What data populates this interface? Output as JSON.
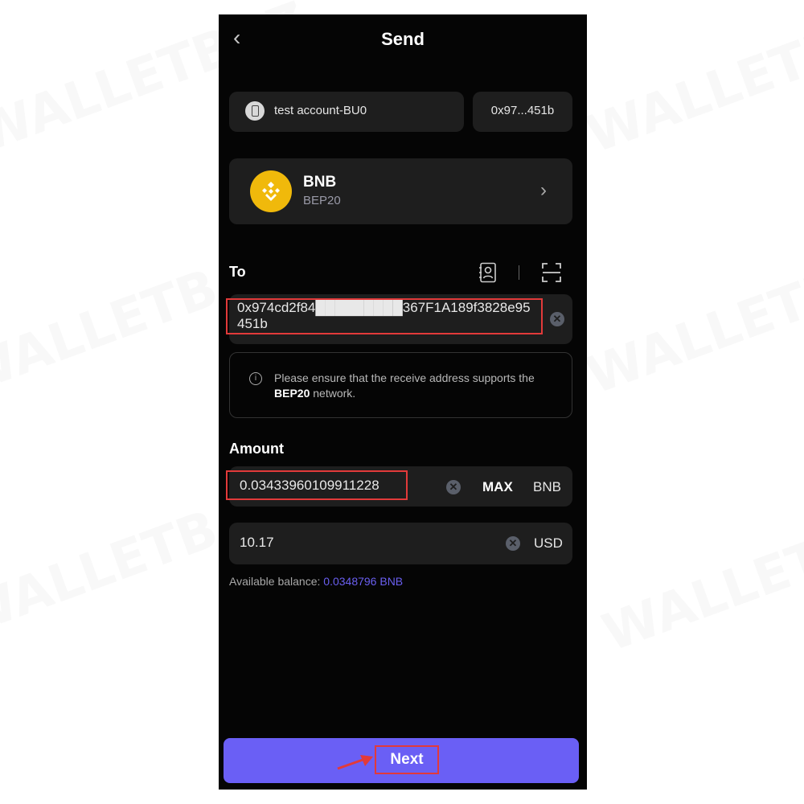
{
  "watermark": "WALLETBAZ",
  "header": {
    "title": "Send",
    "back_icon": "chevron-left-icon"
  },
  "account": {
    "name": "test account-BU0",
    "address_short": "0x97...451b"
  },
  "token": {
    "symbol": "BNB",
    "network": "BEP20"
  },
  "to": {
    "label": "To",
    "address": "0x974cd2f84█████████367F1A189f3828e95451b",
    "contacts_icon": "address-book-icon",
    "scan_icon": "scan-qr-icon"
  },
  "notice": {
    "text_before": "Please ensure that the receive address supports the ",
    "network": "BEP20",
    "text_after": " network."
  },
  "amount": {
    "label": "Amount",
    "crypto_value": "0.03433960109911228",
    "max_label": "MAX",
    "crypto_unit": "BNB",
    "fiat_value": "10.17",
    "fiat_unit": "USD",
    "balance_label": "Available balance: ",
    "balance_value": "0.0348796 BNB"
  },
  "next_button": {
    "label": "Next"
  },
  "colors": {
    "accent": "#6a5ff5",
    "highlight": "#e23a3a",
    "bnb": "#f0b90b"
  }
}
